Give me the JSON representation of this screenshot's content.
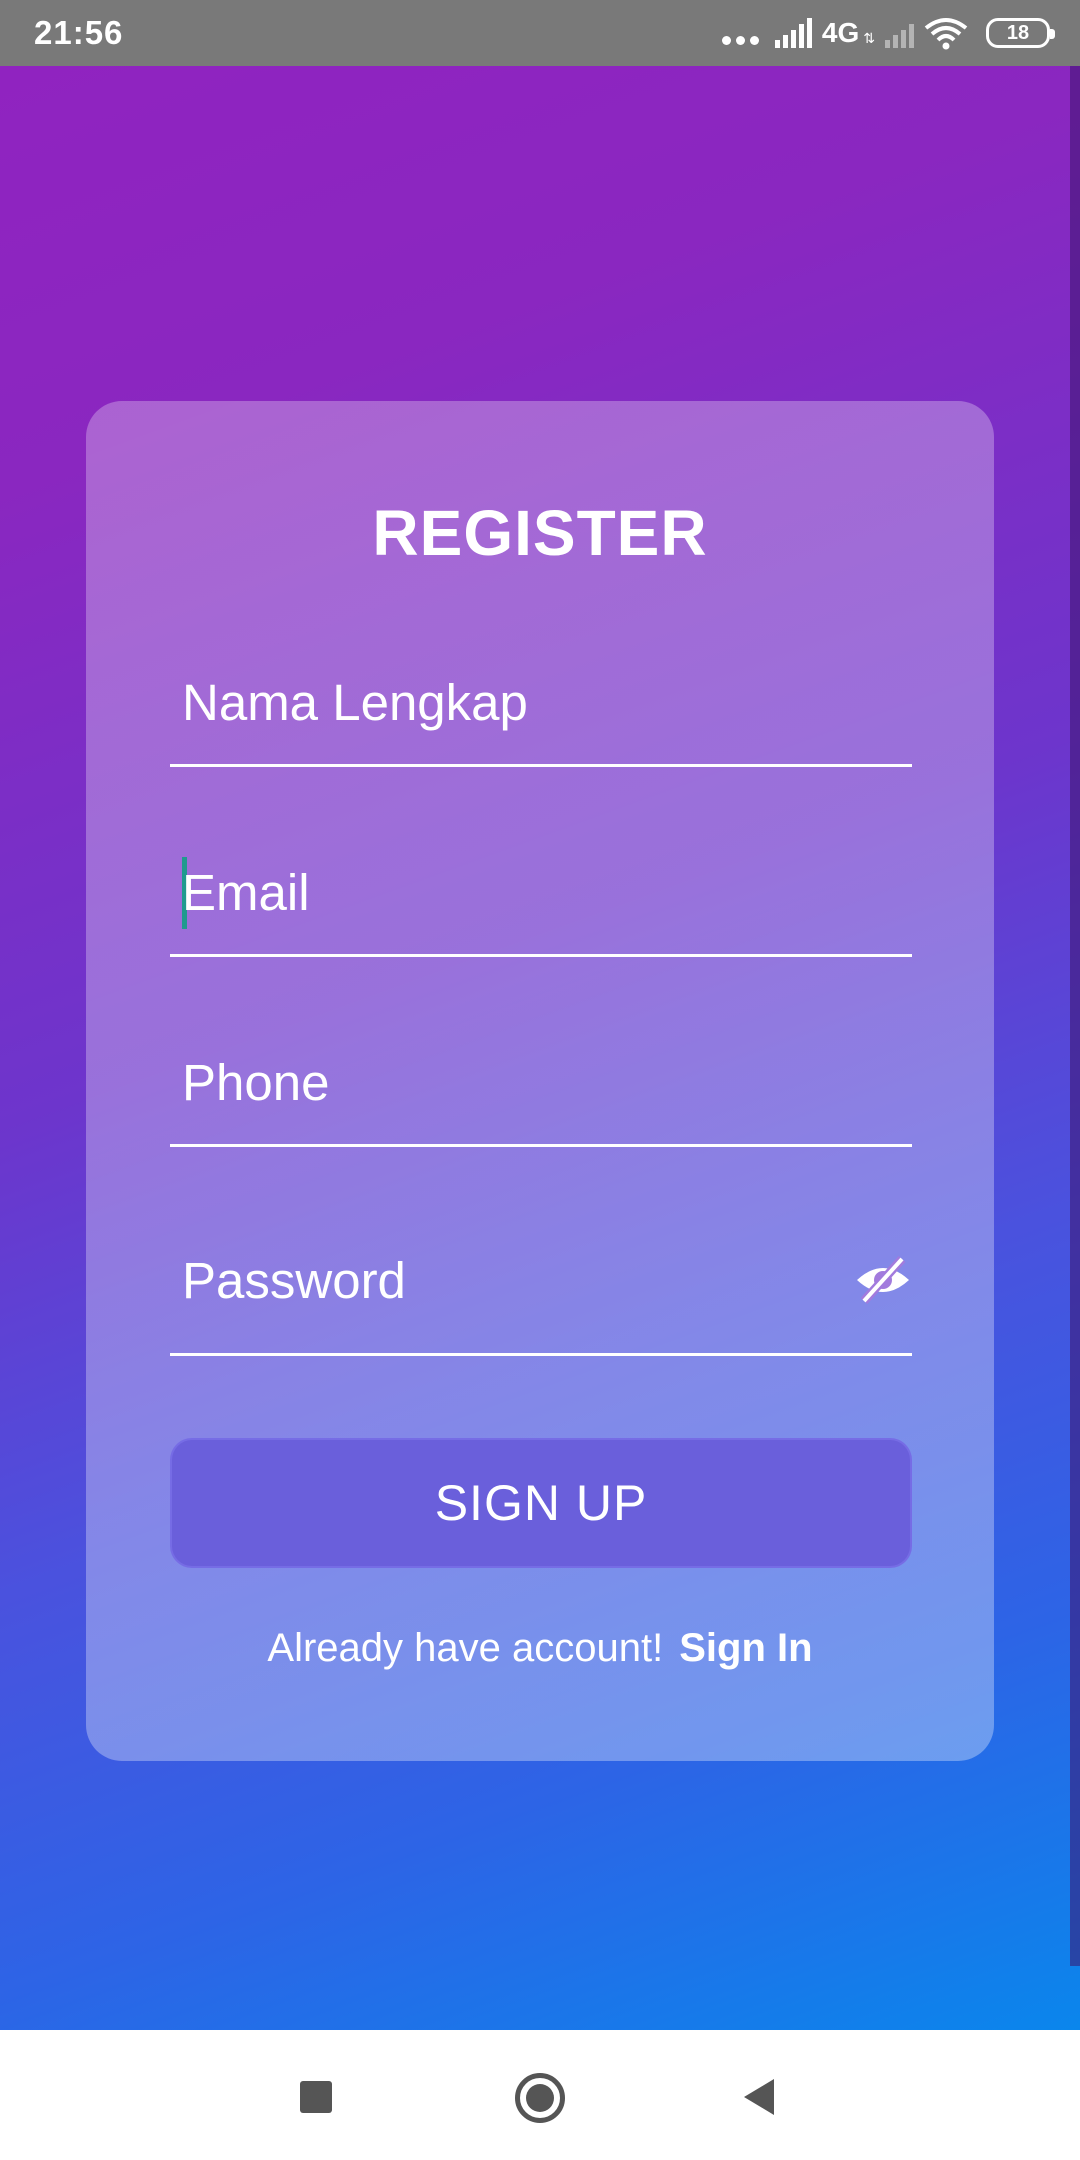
{
  "status_bar": {
    "time": "21:56",
    "network": "4G",
    "battery": "18"
  },
  "register": {
    "title": "REGISTER",
    "fields": {
      "name_placeholder": "Nama Lengkap",
      "email_placeholder": "Email",
      "phone_placeholder": "Phone",
      "password_placeholder": "Password"
    },
    "signup_label": "SIGN UP",
    "footer_text": "Already have account!",
    "signin_link": "Sign In"
  },
  "colors": {
    "gradient_top": "#9023c0",
    "gradient_bottom": "#0a86ec",
    "button": "#6a5fdb",
    "cursor": "#1f9a8f"
  },
  "icons": [
    "eye-off-icon",
    "recent-apps-icon",
    "home-icon",
    "back-icon"
  ]
}
